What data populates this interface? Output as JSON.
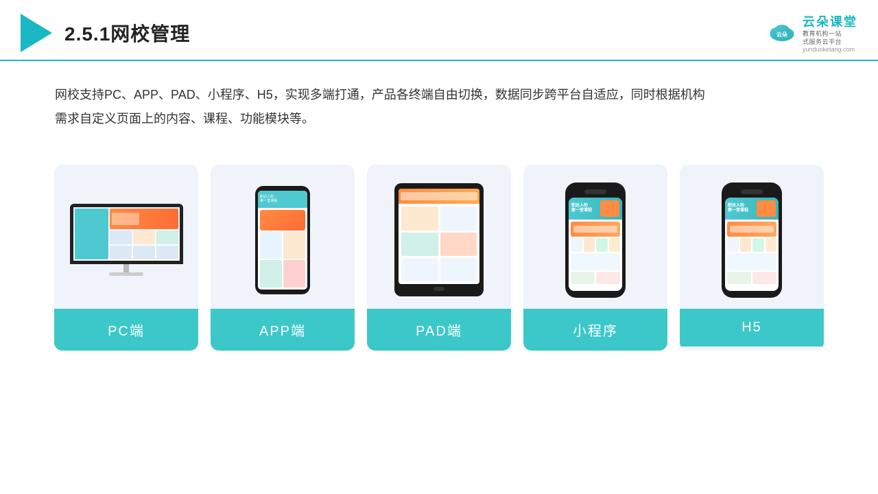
{
  "header": {
    "title": "2.5.1网校管理",
    "brand_name": "云朵课堂",
    "brand_sub1": "教育机构一站",
    "brand_sub2": "式服务云平台",
    "brand_url": "yunduoketang.com"
  },
  "description": {
    "line1": "网校支持PC、APP、PAD、小程序、H5，实现多端打通，产品各终端自由切换，数据同步跨平台自适应，同时根据机构",
    "line2": "需求自定义页面上的内容、课程、功能模块等。"
  },
  "cards": [
    {
      "id": "pc",
      "label": "PC端"
    },
    {
      "id": "app",
      "label": "APP端"
    },
    {
      "id": "pad",
      "label": "PAD端"
    },
    {
      "id": "miniprogram",
      "label": "小程序"
    },
    {
      "id": "h5",
      "label": "H5"
    }
  ],
  "colors": {
    "accent": "#3cc8c8",
    "header_border": "#1ab8c4",
    "card_bg": "#f0f4fa"
  }
}
